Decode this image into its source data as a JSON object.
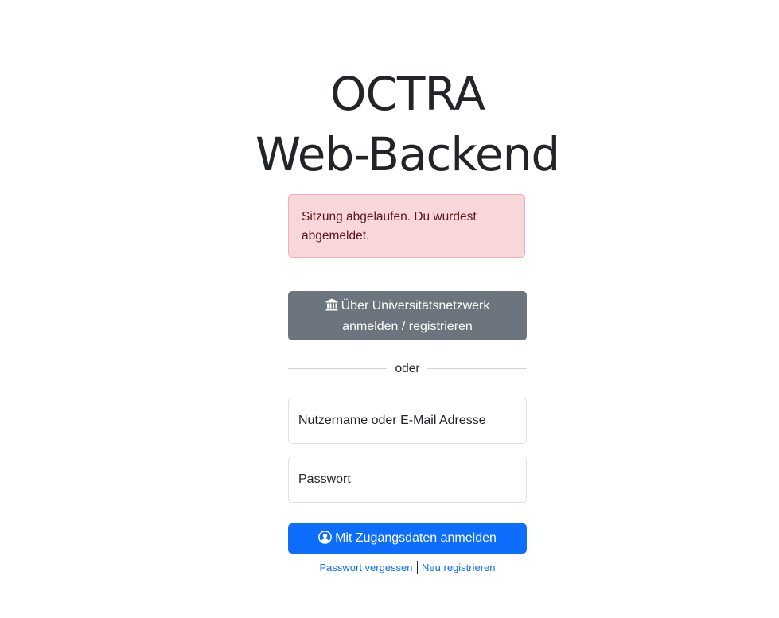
{
  "header": {
    "title_line1": "OCTRA",
    "title_line2": "Web-Backend"
  },
  "alert": {
    "message": "Sitzung abgelaufen. Du wurdest abgemeldet.",
    "color_background": "#f8d7da",
    "color_text": "#58151c"
  },
  "sso": {
    "icon": "bank-icon",
    "label": "Über Universitätsnetzwerk anmelden / registrieren",
    "color": "#6c757d"
  },
  "divider": {
    "label": "oder"
  },
  "form": {
    "username_placeholder": "Nutzername oder E-Mail Adresse",
    "username_value": "",
    "password_placeholder": "Passwort",
    "password_value": "",
    "submit_icon": "user-circle-icon",
    "submit_label": "Mit Zugangsdaten anmelden",
    "submit_color": "#0d6efd"
  },
  "links": {
    "forgot_password": "Passwort vergessen",
    "register": "Neu registrieren"
  }
}
